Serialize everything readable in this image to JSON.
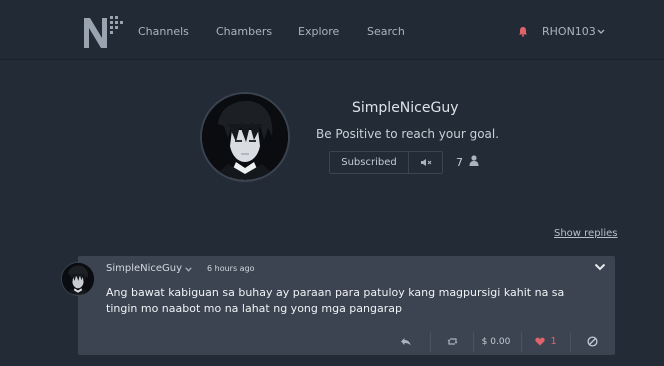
{
  "nav": {
    "items": [
      "Channels",
      "Chambers",
      "Explore",
      "Search"
    ],
    "username": "RHON103"
  },
  "profile": {
    "name": "SimpleNiceGuy",
    "tagline": "Be Positive to reach your goal.",
    "subscribe_label": "Subscribed",
    "subscriber_count": "7"
  },
  "show_replies": "Show replies",
  "comment": {
    "author": "SimpleNiceGuy",
    "time": "6 hours ago",
    "body": "Ang bawat kabiguan sa buhay ay paraan para patuloy kang magpursigi kahit na sa tingin mo naabot mo na lahat ng yong mga pangarap",
    "tip_amount": "$ 0.00",
    "likes": "1"
  },
  "colors": {
    "background": "#232b36",
    "card": "#3b4450",
    "accent_red": "#e0626a"
  }
}
